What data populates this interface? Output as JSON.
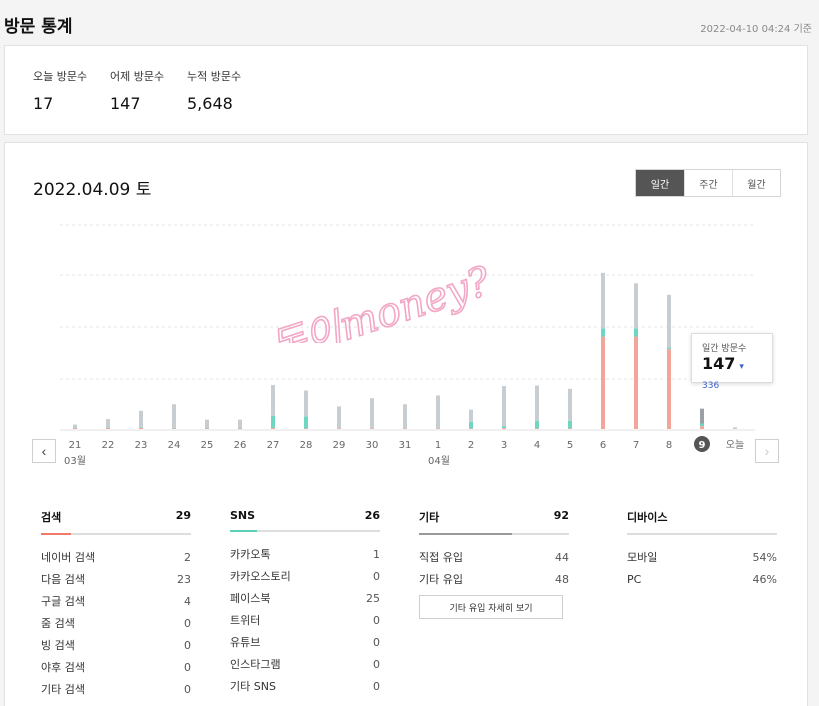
{
  "header": {
    "title": "방문 통계",
    "timestamp": "2022-04-10 04:24 기준"
  },
  "summary": {
    "today": {
      "label": "오늘 방문수",
      "value": "17"
    },
    "yesterday": {
      "label": "어제 방문수",
      "value": "147"
    },
    "total": {
      "label": "누적 방문수",
      "value": "5,648"
    }
  },
  "main": {
    "date_title": "2022.04.09 토",
    "tabs": [
      {
        "label": "일간"
      },
      {
        "label": "주간"
      },
      {
        "label": "월간"
      }
    ],
    "active_tab": "일간",
    "month_labels": {
      "march": "03월",
      "april": "04월"
    },
    "tooltip": {
      "label": "일간 방문수",
      "value": "147",
      "delta": "336"
    },
    "watermark": "돈이money?",
    "nav": {
      "prev": "‹",
      "next": "›"
    }
  },
  "chart_data": {
    "type": "bar",
    "stacked": true,
    "categories": [
      "21",
      "22",
      "23",
      "24",
      "25",
      "26",
      "27",
      "28",
      "29",
      "30",
      "31",
      "1",
      "2",
      "3",
      "4",
      "5",
      "6",
      "7",
      "8",
      "9",
      "오늘"
    ],
    "selected_category": "9",
    "series": [
      {
        "values": [
          2,
          2,
          2,
          1,
          2,
          2,
          2,
          1,
          1,
          1,
          1,
          1,
          1,
          2,
          1,
          1,
          168,
          168,
          145,
          5,
          0
        ],
        "color": "#f4a59b"
      },
      {
        "values": [
          1,
          1,
          1,
          1,
          1,
          1,
          22,
          22,
          0,
          0,
          0,
          0,
          12,
          4,
          14,
          14,
          15,
          15,
          3,
          5,
          0
        ],
        "color": "#6fd6c1"
      },
      {
        "values": [
          5,
          15,
          30,
          43,
          14,
          14,
          56,
          47,
          40,
          55,
          44,
          60,
          22,
          72,
          64,
          58,
          101,
          82,
          96,
          27,
          3
        ],
        "color": "#c8cdd2"
      }
    ],
    "colors": {
      "search": "#f07a6a",
      "sns": "#5ccfb8",
      "other": "#bfc4c9",
      "selected_marker": "#555555"
    }
  },
  "categories": {
    "search": {
      "title": "검색",
      "total": "29",
      "color": "#f07a6a",
      "items": [
        {
          "label": "네이버 검색",
          "value": "2"
        },
        {
          "label": "다음 검색",
          "value": "23"
        },
        {
          "label": "구글 검색",
          "value": "4"
        },
        {
          "label": "줌 검색",
          "value": "0"
        },
        {
          "label": "빙 검색",
          "value": "0"
        },
        {
          "label": "야후 검색",
          "value": "0"
        },
        {
          "label": "기타 검색",
          "value": "0"
        }
      ]
    },
    "sns": {
      "title": "SNS",
      "total": "26",
      "color": "#5ccfb8",
      "items": [
        {
          "label": "카카오톡",
          "value": "1"
        },
        {
          "label": "카카오스토리",
          "value": "0"
        },
        {
          "label": "페이스북",
          "value": "25"
        },
        {
          "label": "트위터",
          "value": "0"
        },
        {
          "label": "유튜브",
          "value": "0"
        },
        {
          "label": "인스타그램",
          "value": "0"
        },
        {
          "label": "기타 SNS",
          "value": "0"
        }
      ]
    },
    "other": {
      "title": "기타",
      "total": "92",
      "color": "#999999",
      "items": [
        {
          "label": "직접 유입",
          "value": "44"
        },
        {
          "label": "기타 유입",
          "value": "48"
        }
      ],
      "detail_button": "기타 유입 자세히 보기"
    },
    "device": {
      "title": "디바이스",
      "total": "",
      "items": [
        {
          "label": "모바일",
          "value": "54%"
        },
        {
          "label": "PC",
          "value": "46%"
        }
      ]
    }
  }
}
